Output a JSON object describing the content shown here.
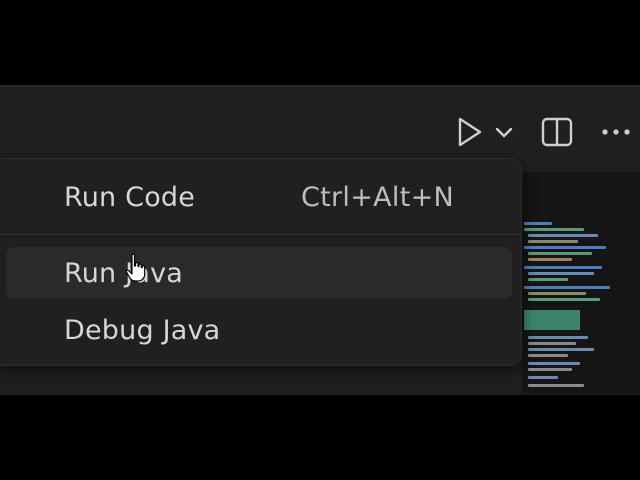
{
  "toolbar": {
    "run_icon": "play-icon",
    "run_dropdown_icon": "chevron-down-icon",
    "split_icon": "split-editor-icon",
    "more_icon": "ellipsis-icon"
  },
  "menu": {
    "items": [
      {
        "label": "Run Code",
        "shortcut": "Ctrl+Alt+N"
      },
      {
        "label": "Run Java",
        "shortcut": ""
      },
      {
        "label": "Debug Java",
        "shortcut": ""
      }
    ],
    "hovered_item": "Run Java"
  },
  "colors": {
    "background": "#1f1f1f",
    "menu_background": "#202020",
    "menu_hover": "#2a2a2a",
    "text": "#d6d6d6",
    "minimap_accent": "#4aa88a"
  }
}
